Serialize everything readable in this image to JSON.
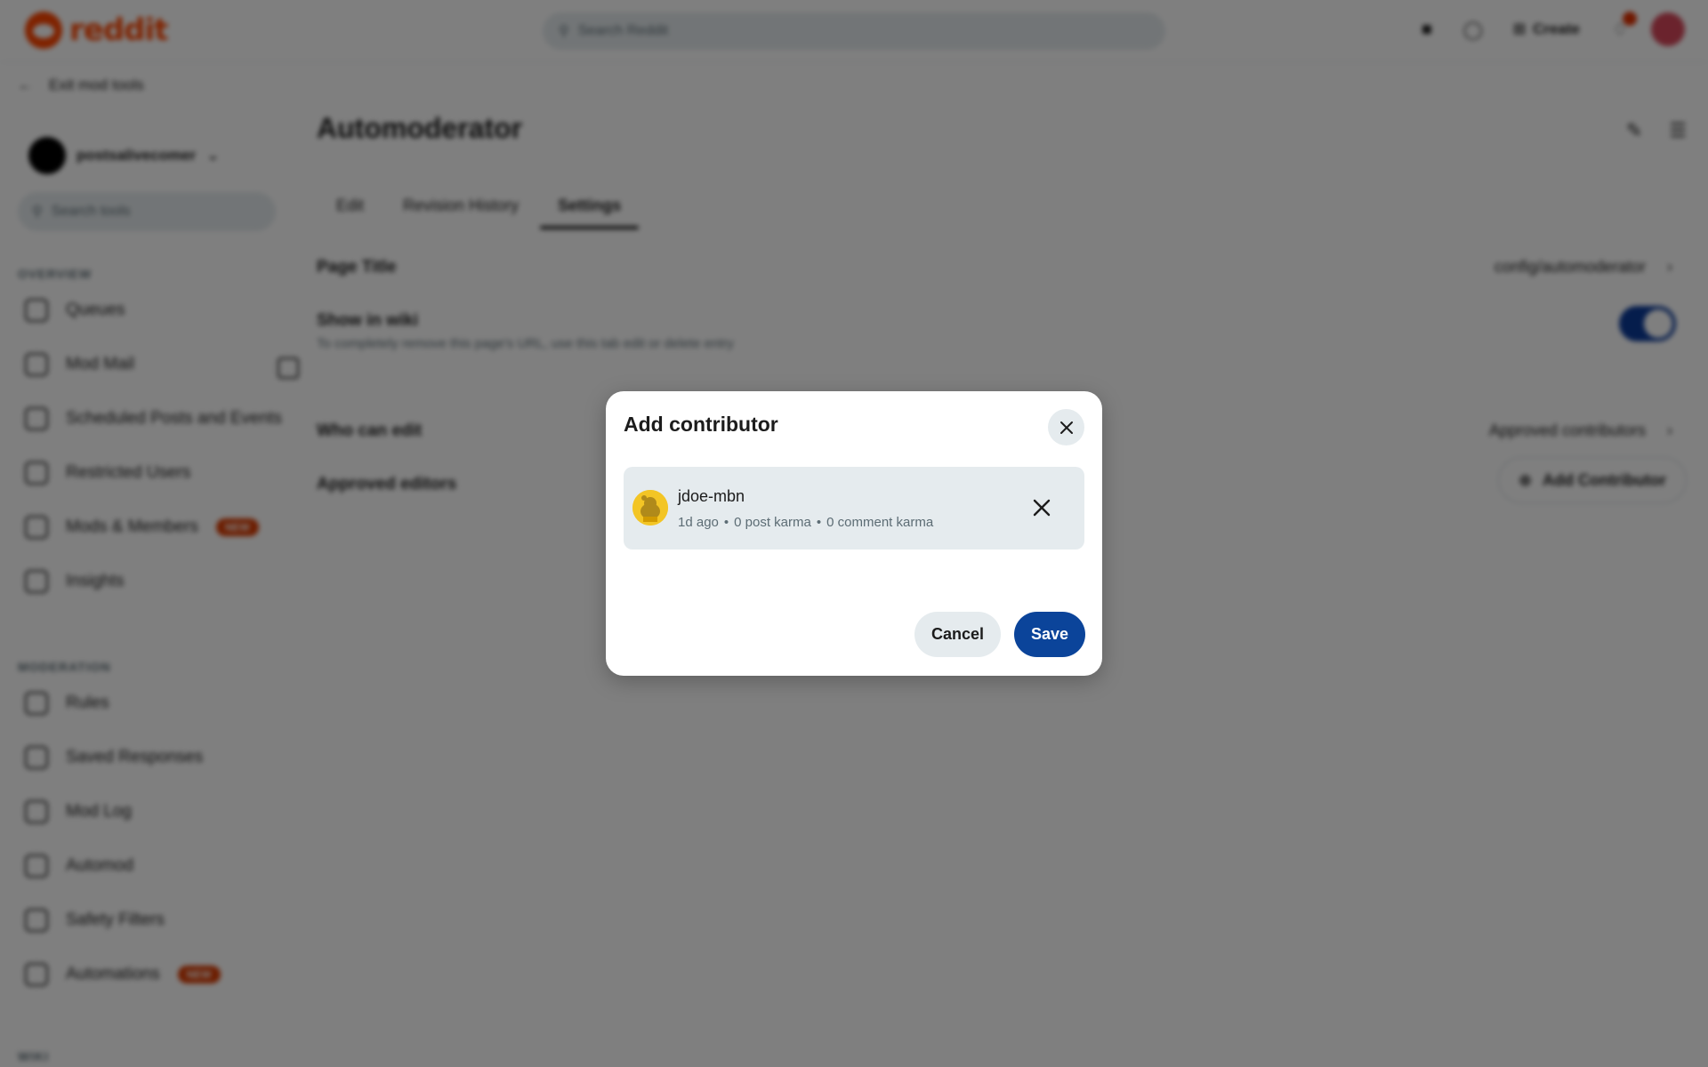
{
  "header": {
    "logo_text": "reddit",
    "search_placeholder": "Search Reddit",
    "create_label": "Create"
  },
  "back_link": {
    "label": "Exit mod tools"
  },
  "sidebar": {
    "subreddit_name": "postsalivecomer",
    "quick_search_placeholder": "Search tools",
    "sections": [
      {
        "title": "OVERVIEW",
        "items": [
          {
            "label": "Queues"
          },
          {
            "label": "Mod Mail"
          },
          {
            "label": "Scheduled Posts and Events"
          },
          {
            "label": "Restricted Users"
          },
          {
            "label": "Mods & Members",
            "badge": "NEW"
          },
          {
            "label": "Insights"
          }
        ]
      },
      {
        "title": "MODERATION",
        "items": [
          {
            "label": "Rules"
          },
          {
            "label": "Saved Responses"
          },
          {
            "label": "Mod Log"
          },
          {
            "label": "Automod"
          },
          {
            "label": "Safety Filters"
          },
          {
            "label": "Automations",
            "badge": "NEW"
          }
        ]
      },
      {
        "title": "WIKI",
        "items": []
      }
    ]
  },
  "main": {
    "page_title": "Automoderator",
    "tabs": [
      {
        "label": "Edit"
      },
      {
        "label": "Revision History"
      },
      {
        "label": "Settings",
        "active": true
      }
    ],
    "settings": {
      "page_title_label": "Page Title",
      "page_title_value": "config/automoderator",
      "show_in_wiki_label": "Show in wiki",
      "show_in_wiki_desc": "To completely remove this page's URL, use this tab edit or delete entry",
      "show_in_wiki_on": true,
      "who_can_edit_label": "Who can edit",
      "who_can_edit_value": "Approved contributors",
      "approved_editors_label": "Approved editors",
      "add_contributor_button": "Add Contributor"
    }
  },
  "modal": {
    "title": "Add contributor",
    "user": {
      "username": "jdoe-mbn",
      "age": "1d ago",
      "post_karma": "0 post karma",
      "comment_karma": "0 comment karma",
      "separator": "•"
    },
    "cancel_label": "Cancel",
    "save_label": "Save"
  },
  "colors": {
    "accent": "#0b449a",
    "brand": "#ff4500",
    "surface": "#e5ebee",
    "overlay": "rgba(0,0,0,0.5)"
  },
  "icons": {
    "close": "close-icon",
    "remove": "remove-icon",
    "user_avatar": "snoo-avatar-icon"
  }
}
